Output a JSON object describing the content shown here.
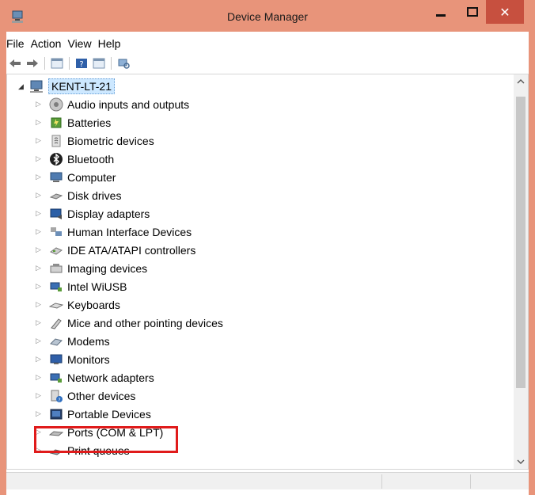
{
  "window": {
    "title": "Device Manager",
    "close_glyph": "✕"
  },
  "menu": [
    "File",
    "Action",
    "View",
    "Help"
  ],
  "tree": {
    "root": "KENT-LT-21",
    "items": [
      {
        "label": "Audio inputs and outputs",
        "icon": "speaker-icon"
      },
      {
        "label": "Batteries",
        "icon": "battery-icon"
      },
      {
        "label": "Biometric devices",
        "icon": "fingerprint-icon"
      },
      {
        "label": "Bluetooth",
        "icon": "bluetooth-icon"
      },
      {
        "label": "Computer",
        "icon": "computer-icon"
      },
      {
        "label": "Disk drives",
        "icon": "disk-icon"
      },
      {
        "label": "Display adapters",
        "icon": "display-icon"
      },
      {
        "label": "Human Interface Devices",
        "icon": "hid-icon"
      },
      {
        "label": "IDE ATA/ATAPI controllers",
        "icon": "ide-icon"
      },
      {
        "label": "Imaging devices",
        "icon": "camera-icon"
      },
      {
        "label": "Intel WiUSB",
        "icon": "network-icon"
      },
      {
        "label": "Keyboards",
        "icon": "keyboard-icon"
      },
      {
        "label": "Mice and other pointing devices",
        "icon": "mouse-icon"
      },
      {
        "label": "Modems",
        "icon": "modem-icon"
      },
      {
        "label": "Monitors",
        "icon": "monitor-icon"
      },
      {
        "label": "Network adapters",
        "icon": "network-icon"
      },
      {
        "label": "Other devices",
        "icon": "unknown-device-icon"
      },
      {
        "label": "Portable Devices",
        "icon": "portable-device-icon"
      },
      {
        "label": "Ports (COM & LPT)",
        "icon": "port-icon"
      },
      {
        "label": "Print queues",
        "icon": "printer-icon"
      }
    ]
  },
  "colors": {
    "frame": "#e8947a",
    "close": "#c7503f",
    "highlight": "#e01b1b",
    "selection": "#cde8ff"
  }
}
